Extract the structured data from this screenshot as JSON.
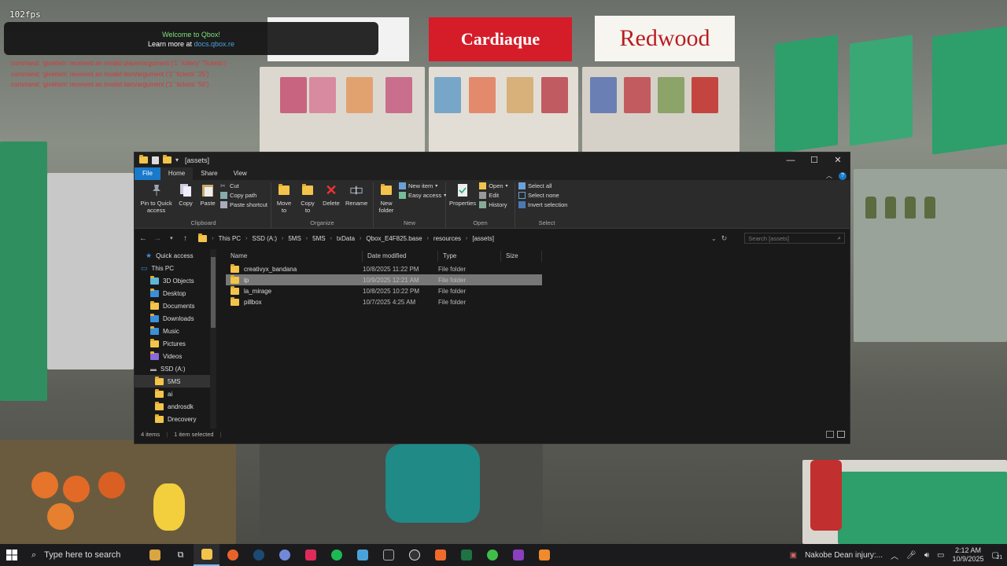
{
  "overlay": {
    "fps": "102fps",
    "welcome_title": "Welcome to Qbox!",
    "welcome_sub_prefix": "Learn more at",
    "welcome_link": "docs.qbox.re",
    "console_lines": [
      "command: 'giveitem' received an invalid player/argument ('1' 'lottery' 'Tickets')",
      "command: 'giveitem' received an invalid item/argument ('1' 'tickets' '25')",
      "command: 'giveitem' received an invalid item/argument ('1' 'tickets' '50')"
    ],
    "signs": [
      "Cardiaque",
      "Redwood"
    ]
  },
  "window": {
    "title": "[assets]",
    "controls": {
      "minimize": "—",
      "maximize": "☐",
      "close": "✕"
    }
  },
  "ribbon_tabs": [
    "File",
    "Home",
    "Share",
    "View"
  ],
  "ribbon": {
    "clipboard": {
      "label": "Clipboard",
      "pin": "Pin to Quick access",
      "copy": "Copy",
      "paste": "Paste",
      "cut": "Cut",
      "copy_path": "Copy path",
      "paste_shortcut": "Paste shortcut"
    },
    "organize": {
      "label": "Organize",
      "move_to": "Move to",
      "copy_to": "Copy to",
      "delete": "Delete",
      "rename": "Rename"
    },
    "new": {
      "label": "New",
      "new_folder": "New folder",
      "new_item": "New item",
      "easy_access": "Easy access"
    },
    "open": {
      "label": "Open",
      "properties": "Properties",
      "open": "Open",
      "edit": "Edit",
      "history": "History"
    },
    "select": {
      "label": "Select",
      "select_all": "Select all",
      "select_none": "Select none",
      "invert": "Invert selection"
    }
  },
  "address": {
    "crumbs": [
      "This PC",
      "SSD (A:)",
      "5MS",
      "5MS",
      "txData",
      "Qbox_E4F825.base",
      "resources",
      "[assets]"
    ],
    "search_placeholder": "Search [assets]"
  },
  "nav_items": [
    {
      "label": "Quick access",
      "icon": "star-icon",
      "indent": 1
    },
    {
      "label": "This PC",
      "icon": "pc-icon",
      "indent": 0
    },
    {
      "label": "3D Objects",
      "icon": "3d-objects-icon",
      "indent": 2
    },
    {
      "label": "Desktop",
      "icon": "desktop-icon",
      "indent": 2
    },
    {
      "label": "Documents",
      "icon": "documents-icon",
      "indent": 2
    },
    {
      "label": "Downloads",
      "icon": "downloads-icon",
      "indent": 2
    },
    {
      "label": "Music",
      "icon": "music-icon",
      "indent": 2
    },
    {
      "label": "Pictures",
      "icon": "pictures-icon",
      "indent": 2
    },
    {
      "label": "Videos",
      "icon": "videos-icon",
      "indent": 2
    },
    {
      "label": "SSD (A:)",
      "icon": "drive-icon",
      "indent": 2
    },
    {
      "label": "5MS",
      "icon": "folder-icon",
      "indent": 3,
      "selected": true
    },
    {
      "label": "ai",
      "icon": "folder-icon",
      "indent": 3
    },
    {
      "label": "androsdk",
      "icon": "folder-icon",
      "indent": 3
    },
    {
      "label": "Drecovery",
      "icon": "folder-icon",
      "indent": 3
    }
  ],
  "columns": [
    "Name",
    "Date modified",
    "Type",
    "Size"
  ],
  "files": [
    {
      "name": "creativyx_bandana",
      "date": "10/8/2025 11:22 PM",
      "type": "File folder",
      "size": ""
    },
    {
      "name": "ip",
      "date": "10/9/2025 12:21 AM",
      "type": "File folder",
      "size": "",
      "selected": true
    },
    {
      "name": "la_mirage",
      "date": "10/8/2025 10:22 PM",
      "type": "File folder",
      "size": ""
    },
    {
      "name": "pillbox",
      "date": "10/7/2025 4:25 AM",
      "type": "File folder",
      "size": ""
    }
  ],
  "status": {
    "count": "4 items",
    "selected": "1 item selected"
  },
  "taskbar": {
    "search_placeholder": "Type here to search",
    "news": "Nakobe Dean injury:...",
    "time": "2:12 AM",
    "date": "10/9/2025",
    "notif_count": "21"
  },
  "colors": {
    "accent": "#1979ca",
    "folder": "#f3c44b",
    "selected_row": "#777777"
  }
}
